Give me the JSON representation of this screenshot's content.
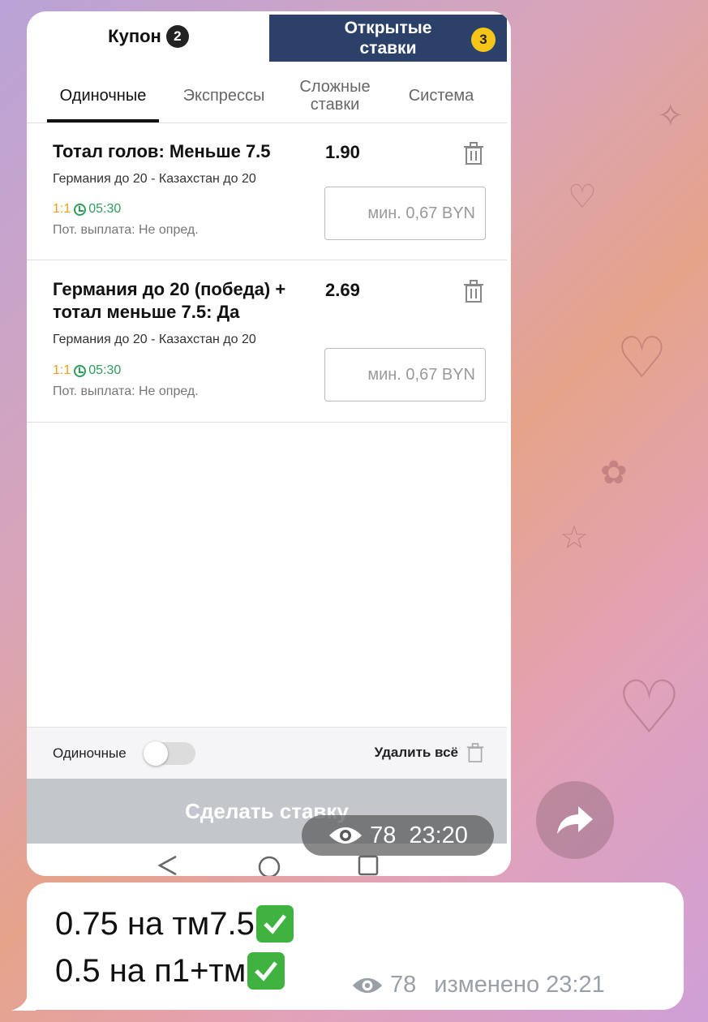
{
  "coupon": {
    "tab_label": "Купон",
    "tab_count": "2",
    "open_bets_label": "Открытые ставки",
    "open_bets_count": "3"
  },
  "subtabs": [
    "Одиночные",
    "Экспрессы",
    "Сложные ставки",
    "Система"
  ],
  "bets": [
    {
      "title": "Тотал голов: Меньше 7.5",
      "odds": "1.90",
      "match": "Германия до 20 - Казахстан до 20",
      "score": "1:1",
      "time": "05:30",
      "payout": "Пот. выплата: Не опред.",
      "stake_placeholder": "мин. 0,67 BYN"
    },
    {
      "title": "Германия до 20 (победа) + тотал меньше 7.5: Да",
      "odds": "2.69",
      "match": "Германия до 20 - Казахстан до 20",
      "score": "1:1",
      "time": "05:30",
      "payout": "Пот. выплата: Не опред.",
      "stake_placeholder": "мин. 0,67 BYN"
    }
  ],
  "footer": {
    "singles_label": "Одиночные",
    "delete_all_label": "Удалить всё",
    "make_bet_label": "Сделать ставку"
  },
  "photo_meta": {
    "views": "78",
    "time": "23:20"
  },
  "message": {
    "line1": "0.75 на тм7.5",
    "line2": "0.5 на п1+тм",
    "views": "78",
    "edited_time": "изменено 23:21"
  },
  "colors": {
    "open_tab_bg": "#2c4169",
    "badge_yellow": "#f5c518",
    "score_orange": "#e8a21a",
    "time_green": "#2e9d5a",
    "check_green": "#3fb23f",
    "make_bet_disabled": "#c3c7cc"
  }
}
